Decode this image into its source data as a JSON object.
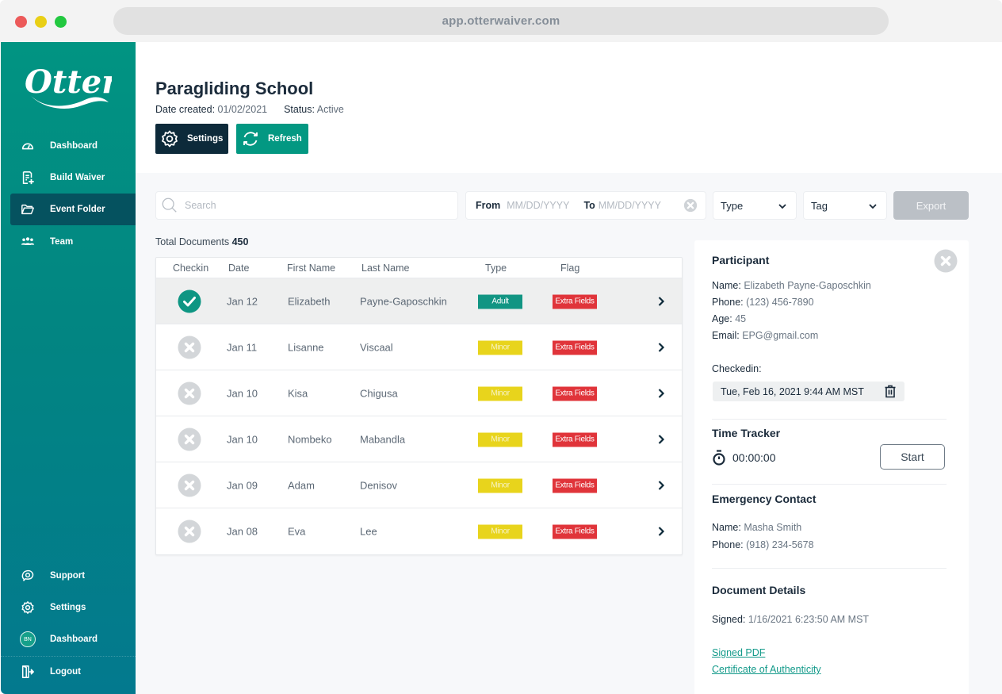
{
  "browser": {
    "url": "app.otterwaiver.com"
  },
  "sidebar": {
    "logo_text": "Otter",
    "items": [
      {
        "label": "Dashboard",
        "icon": "gauge-icon"
      },
      {
        "label": "Build Waiver",
        "icon": "document-add-icon"
      },
      {
        "label": "Event Folder",
        "icon": "folder-open-icon",
        "active": true
      },
      {
        "label": "Team",
        "icon": "team-icon"
      }
    ],
    "bottom_items": [
      {
        "label": "Support",
        "icon": "support-icon"
      },
      {
        "label": "Settings",
        "icon": "gear-icon"
      },
      {
        "label": "Dashboard",
        "icon": "avatar",
        "avatar_initials": "BN"
      },
      {
        "label": "Logout",
        "icon": "logout-icon"
      }
    ]
  },
  "header": {
    "title": "Paragliding School",
    "date_created_label": "Date created:",
    "date_created": "01/02/2021",
    "status_label": "Status:",
    "status": "Active",
    "settings_label": "Settings",
    "refresh_label": "Refresh"
  },
  "filters": {
    "search_placeholder": "Search",
    "from_label": "From",
    "from_placeholder": "MM/DD/YYYY",
    "to_label": "To",
    "to_placeholder": "MM/DD/YYYY",
    "type_label": "Type",
    "tag_label": "Tag",
    "export_label": "Export"
  },
  "summary": {
    "total_label": "Total Documents",
    "total": "450"
  },
  "table": {
    "columns": [
      "Checkin",
      "Date",
      "First Name",
      "Last Name",
      "Type",
      "Flag"
    ],
    "rows": [
      {
        "checked_in": true,
        "date": "Jan 12",
        "first": "Elizabeth",
        "last": "Payne-Gaposchkin",
        "type": "Adult",
        "flag": "Extra Fields",
        "selected": true
      },
      {
        "checked_in": false,
        "date": "Jan 11",
        "first": "Lisanne",
        "last": "Viscaal",
        "type": "Minor",
        "flag": "Extra Fields"
      },
      {
        "checked_in": false,
        "date": "Jan 10",
        "first": "Kisa",
        "last": "Chigusa",
        "type": "Minor",
        "flag": "Extra Fields"
      },
      {
        "checked_in": false,
        "date": "Jan 10",
        "first": "Nombeko",
        "last": "Mabandla",
        "type": "Minor",
        "flag": "Extra Fields"
      },
      {
        "checked_in": false,
        "date": "Jan 09",
        "first": "Adam",
        "last": "Denisov",
        "type": "Minor",
        "flag": "Extra Fields"
      },
      {
        "checked_in": false,
        "date": "Jan 08",
        "first": "Eva",
        "last": "Lee",
        "type": "Minor",
        "flag": "Extra Fields"
      }
    ]
  },
  "detail": {
    "participant_heading": "Participant",
    "name_label": "Name:",
    "name": "Elizabeth Payne-Gaposchkin",
    "phone_label": "Phone:",
    "phone": "(123) 456-7890",
    "age_label": "Age:",
    "age": "45",
    "email_label": "Email:",
    "email": "EPG@gmail.com",
    "checkedin_label": "Checkedin:",
    "checkedin_value": "Tue, Feb 16, 2021 9:44 AM MST",
    "time_tracker_heading": "Time Tracker",
    "timer_value": "00:00:00",
    "start_label": "Start",
    "emergency_heading": "Emergency Contact",
    "em_name_label": "Name:",
    "em_name": "Masha Smith",
    "em_phone_label": "Phone:",
    "em_phone": "(918) 234-5678",
    "doc_heading": "Document Details",
    "signed_label": "Signed:",
    "signed_value": "1/16/2021 6:23:50 AM MST",
    "signed_pdf_link": "Signed PDF",
    "certificate_link": "Certificate of Authenticity"
  },
  "colors": {
    "brand_teal": "#039882",
    "sidebar_active": "#05525f",
    "dark_button": "#0d2a3a",
    "adult_badge": "#119583",
    "minor_badge": "#e8d41c",
    "flag_badge": "#e0343a",
    "link": "#139a8a"
  }
}
